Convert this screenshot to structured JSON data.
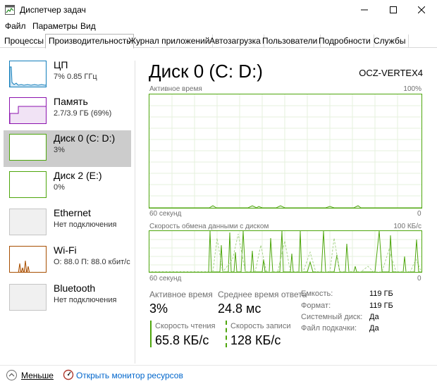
{
  "window": {
    "title": "Диспетчер задач"
  },
  "menu": [
    "Файл",
    "Параметры",
    "Вид"
  ],
  "tabs": [
    {
      "label": "Процессы",
      "active": false
    },
    {
      "label": "Производительность",
      "active": true
    },
    {
      "label": "Журнал приложений",
      "active": false
    },
    {
      "label": "Автозагрузка",
      "active": false
    },
    {
      "label": "Пользователи",
      "active": false
    },
    {
      "label": "Подробности",
      "active": false
    },
    {
      "label": "Службы",
      "active": false
    }
  ],
  "sidebar": {
    "items": [
      {
        "name": "ЦП",
        "sub": "7% 0.85 ГГц",
        "color": "#117dbb",
        "selected": false
      },
      {
        "name": "Память",
        "sub": "2.7/3.9 ГБ (69%)",
        "color": "#8b12ae",
        "selected": false
      },
      {
        "name": "Диск 0 (C: D:)",
        "sub": "3%",
        "color": "#4da60c",
        "selected": true
      },
      {
        "name": "Диск 2 (E:)",
        "sub": "0%",
        "color": "#4da60c",
        "selected": false
      },
      {
        "name": "Ethernet",
        "sub": "Нет подключения",
        "color": "#c4c4c4",
        "selected": false
      },
      {
        "name": "Wi-Fi",
        "sub": "О: 88.0 П: 88.0 кбит/с",
        "color": "#a74f01",
        "selected": false
      },
      {
        "name": "Bluetooth",
        "sub": "Нет подключения",
        "color": "#c4c4c4",
        "selected": false
      }
    ]
  },
  "main": {
    "title": "Диск 0 (C: D:)",
    "model": "OCZ-VERTEX4",
    "chart1": {
      "label": "Активное время",
      "max_label": "100%",
      "time_label": "60 секунд",
      "min_label": "0"
    },
    "chart2": {
      "label": "Скорость обмена данными с диском",
      "max_label": "100 КБ/с",
      "time_label": "60 секунд",
      "min_label": "0"
    },
    "stats": {
      "active_label": "Активное время",
      "active_value": "3%",
      "response_label": "Среднее время ответа",
      "response_value": "24.8 мс",
      "read_label": "Скорость чтения",
      "read_value": "65.8 КБ/с",
      "write_label": "Скорость записи",
      "write_value": "128 КБ/с"
    },
    "info": [
      {
        "label": "Емкость:",
        "value": "119 ГБ"
      },
      {
        "label": "Формат:",
        "value": "119 ГБ"
      },
      {
        "label": "Системный диск:",
        "value": "Да"
      },
      {
        "label": "Файл подкачки:",
        "value": "Да"
      }
    ]
  },
  "footer": {
    "fewer_label": "Меньше",
    "monitor_label": "Открыть монитор ресурсов"
  },
  "colors": {
    "accent_green": "#4da60c",
    "link": "#0066cc"
  }
}
